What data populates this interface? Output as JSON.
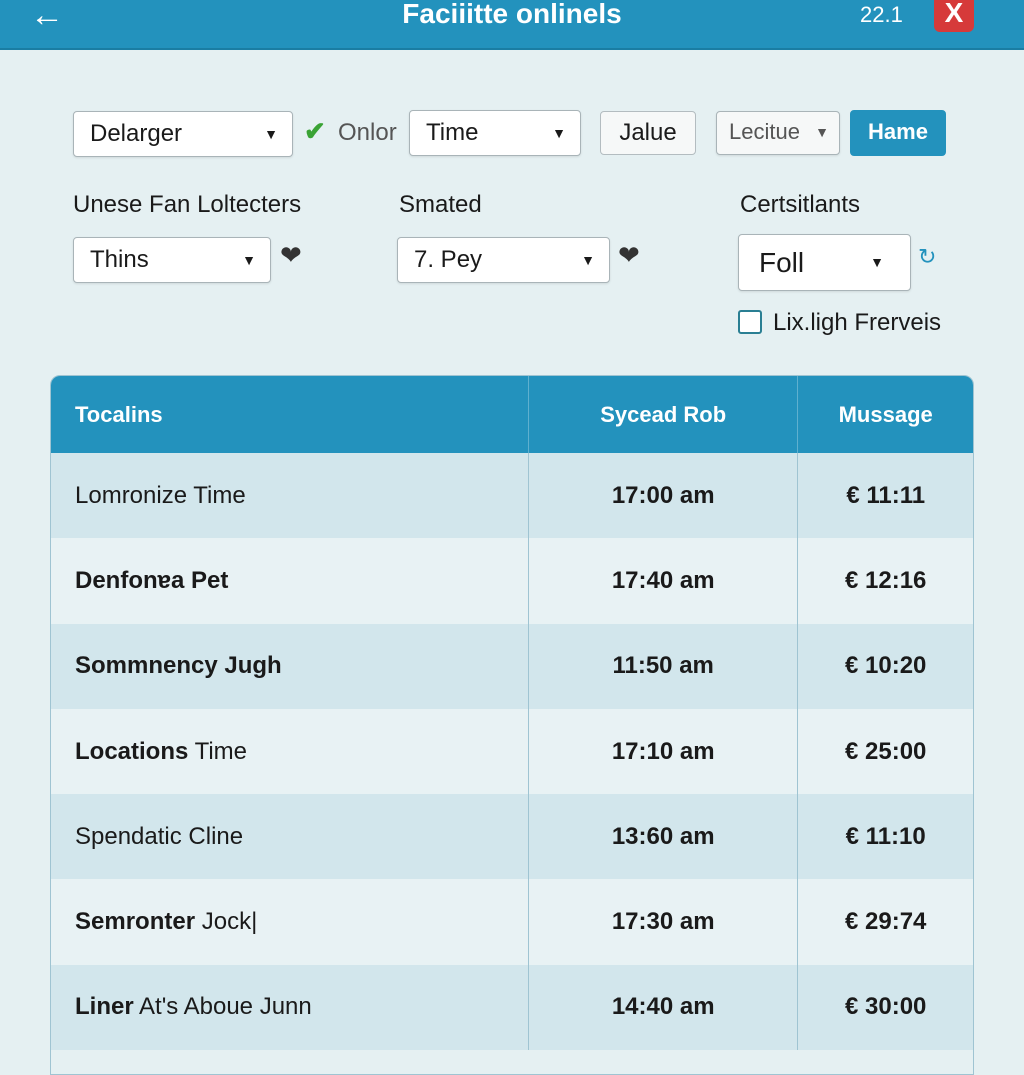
{
  "header": {
    "title": "Faciiitte onlinels",
    "version": "22.1",
    "back_icon": "arrow-left-icon",
    "close_label": "X"
  },
  "toolbar": {
    "select1": "Delarger",
    "status_label": "Onlor",
    "select2": "Time",
    "button1": "Jalue",
    "select3": "Lecitue",
    "primary_button": "Hame"
  },
  "filters": [
    {
      "label": "Unese Fan Loltecters",
      "value": "Thins"
    },
    {
      "label": "Smated",
      "value": "7. Pey"
    },
    {
      "label": "Certsitlants",
      "value": "Foll"
    }
  ],
  "checkbox": {
    "label": "Lix.ligh Frerveis",
    "checked": false
  },
  "colors": {
    "accent": "#2392bd",
    "close": "#d63a3a",
    "check": "#3aa335"
  },
  "table": {
    "columns": [
      "Tocalins",
      "Sycead Rob",
      "Mussage"
    ],
    "rows": [
      {
        "bold": "",
        "name": "Lomronize Time",
        "time": "17:00 am",
        "value": "€ 11:11"
      },
      {
        "bold": "Denfonɐa Pet",
        "name": "",
        "time": "17:40 am",
        "value": "€ 12:16"
      },
      {
        "bold": "Sommnency Jugh",
        "name": "",
        "time": "11:50 am",
        "value": "€ 10:20"
      },
      {
        "bold": "Locations",
        "name": " Time",
        "time": "17:10 am",
        "value": "€ 25:00"
      },
      {
        "bold": "",
        "name": "Spendatic Cline",
        "time": "13:60 am",
        "value": "€ 11:10"
      },
      {
        "bold": "Semronter",
        "name": " Jock|",
        "time": "17:30 am",
        "value": "€ 29:74"
      },
      {
        "bold": "Liner",
        "name": " At's Aboue Junn",
        "time": "14:40 am",
        "value": "€ 30:00"
      }
    ]
  }
}
